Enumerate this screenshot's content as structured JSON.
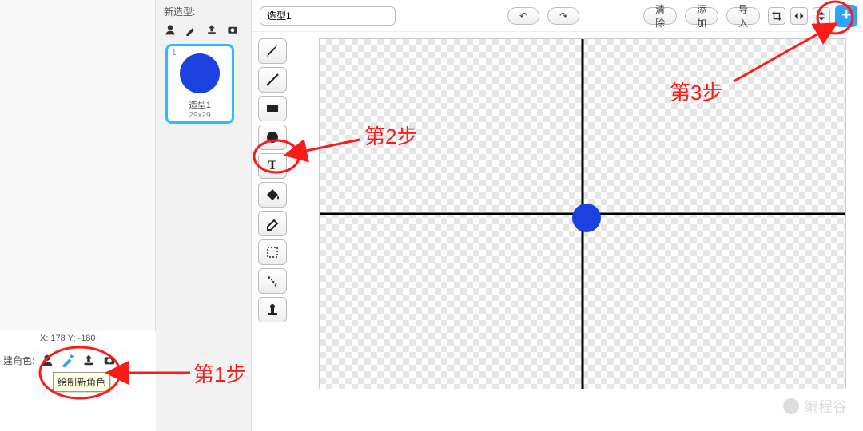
{
  "costume_panel": {
    "new_label": "新造型:",
    "thumb": {
      "index": "1",
      "name": "造型1",
      "size": "29x29"
    },
    "icons": {
      "sprite": "sprite-icon",
      "paint": "paint-icon",
      "upload": "upload-icon",
      "camera": "camera-icon"
    }
  },
  "sprite_bar": {
    "label": "建角色:",
    "tooltip": "绘制新角色",
    "coords": "X: 178   Y: -180"
  },
  "editor": {
    "name_value": "造型1",
    "buttons": {
      "undo": "↶",
      "redo": "↷",
      "clear": "清除",
      "add": "添加",
      "import": "导入"
    },
    "right_icons": {
      "crop": "✂",
      "flip_h": "⇋",
      "flip_v": "⇵",
      "plus": "+"
    },
    "tools": {
      "brush": "brush-icon",
      "line": "line-icon",
      "rect": "rect-icon",
      "ellipse": "ellipse-icon",
      "text": "T",
      "fill": "fill-icon",
      "erase": "erase-icon",
      "select": "select-icon",
      "wand": "wand-icon",
      "stamp": "stamp-icon"
    }
  },
  "annotations": {
    "step1": "第1步",
    "step2": "第2步",
    "step3": "第3步"
  },
  "watermark": {
    "icon": "೦",
    "text": "编程谷"
  }
}
